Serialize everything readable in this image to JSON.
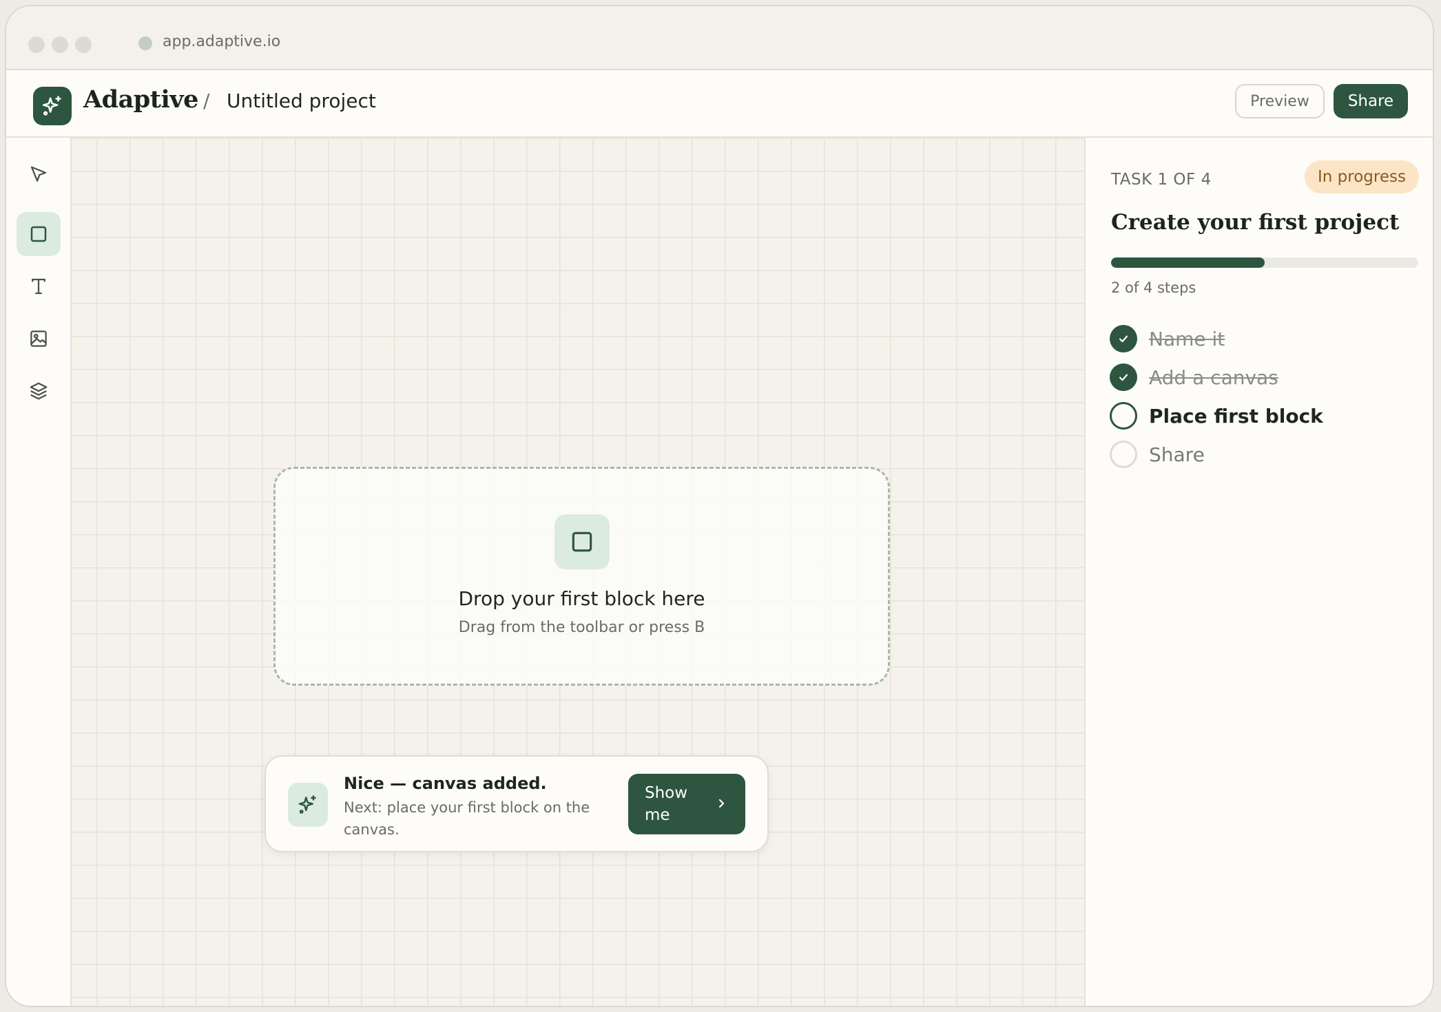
{
  "browser": {
    "url": "app.adaptive.io"
  },
  "header": {
    "brand": "Adaptive",
    "separator": "/",
    "project_title": "Untitled project",
    "preview_label": "Preview",
    "share_label": "Share"
  },
  "toolbar": {
    "tools": [
      {
        "name": "select",
        "icon": "cursor-icon",
        "active": false
      },
      {
        "name": "block",
        "icon": "square-icon",
        "active": true
      },
      {
        "name": "text",
        "icon": "text-icon",
        "active": false
      },
      {
        "name": "image",
        "icon": "image-icon",
        "active": false
      },
      {
        "name": "layers",
        "icon": "layers-icon",
        "active": false
      }
    ]
  },
  "canvas": {
    "dropzone": {
      "title": "Drop your first block here",
      "subtitle": "Drag from the toolbar or press B"
    }
  },
  "toast": {
    "title": "Nice — canvas added.",
    "body": "Next: place your first block on the canvas.",
    "action_label": "Show me"
  },
  "task_panel": {
    "task_counter": "TASK 1 OF 4",
    "status": "In progress",
    "title": "Create your first project",
    "progress_fraction": 0.5,
    "progress_text": "2 of 4 steps",
    "steps": [
      {
        "label": "Name it",
        "state": "done"
      },
      {
        "label": "Add a canvas",
        "state": "done"
      },
      {
        "label": "Place first block",
        "state": "current"
      },
      {
        "label": "Share",
        "state": "todo"
      }
    ]
  },
  "colors": {
    "accent": "#2d553f",
    "accent_soft": "#dcebe0",
    "badge_bg": "#fbe5c6",
    "badge_text": "#8a5a22"
  }
}
